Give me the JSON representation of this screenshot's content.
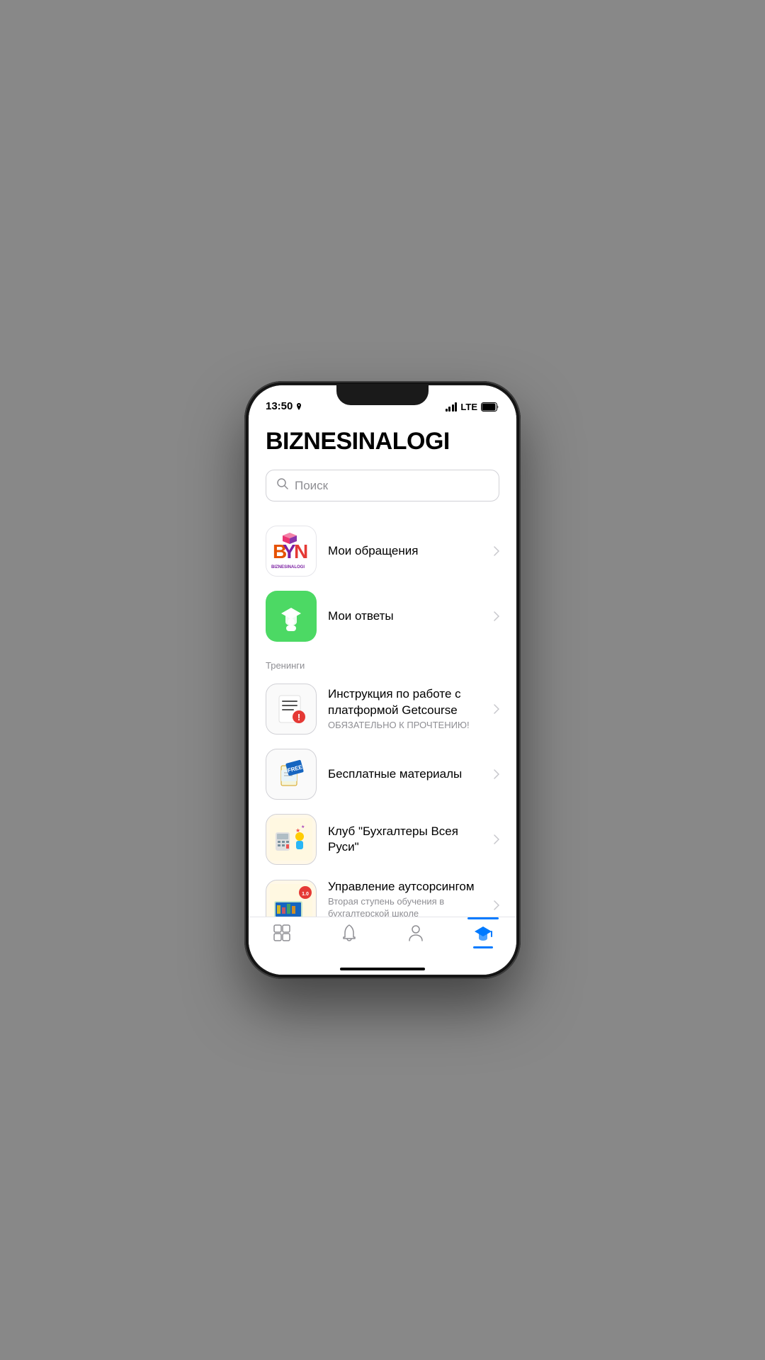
{
  "status_bar": {
    "time": "13:50",
    "carrier": "LTE"
  },
  "header": {
    "title": "BIZNESINALOGI"
  },
  "search": {
    "placeholder": "Поиск"
  },
  "menu_items": [
    {
      "id": "my-requests",
      "title": "Мои обращения",
      "subtitle": "",
      "icon_type": "bin-logo"
    },
    {
      "id": "my-answers",
      "title": "Мои ответы",
      "subtitle": "",
      "icon_type": "grad-green"
    }
  ],
  "section_label": "Тренинги",
  "training_items": [
    {
      "id": "getcourse-instruction",
      "title": "Инструкция по работе с платформой Getcourse",
      "subtitle": "ОБЯЗАТЕЛЬНО К ПРОЧТЕНИЮ!",
      "icon_type": "instruction"
    },
    {
      "id": "free-materials",
      "title": "Бесплатные материалы",
      "subtitle": "",
      "icon_type": "free"
    },
    {
      "id": "accountants-club",
      "title": "Клуб \"Бухгалтеры Всея Руси\"",
      "subtitle": "",
      "icon_type": "club"
    },
    {
      "id": "outsourcing-mgmt",
      "title": "Управление аутсорсингом",
      "subtitle": "Вторая ступень обучения в бухгалтерской школе \"BIZNESINALO...",
      "icon_type": "management",
      "version": "1.0"
    }
  ],
  "bottom_nav": [
    {
      "id": "courses",
      "label": "Курсы",
      "icon": "grid",
      "active": false
    },
    {
      "id": "notifications",
      "label": "Уведомления",
      "icon": "bell",
      "active": false
    },
    {
      "id": "profile",
      "label": "Профиль",
      "icon": "person",
      "active": false
    },
    {
      "id": "training",
      "label": "Обучение",
      "icon": "graduation",
      "active": true
    }
  ]
}
